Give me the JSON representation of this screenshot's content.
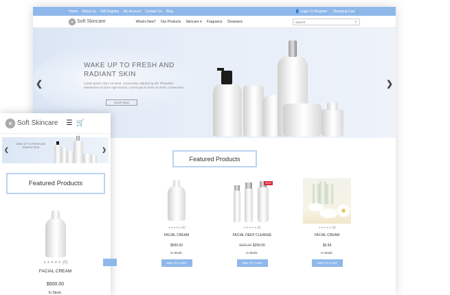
{
  "topbar": {
    "links": [
      "Home",
      "About Us",
      "Gift Registry",
      "My Account",
      "Contact Us",
      "Blog"
    ],
    "login": "Login Or Register",
    "cart": "Shopping Cart"
  },
  "brand": "Soft Skincare",
  "nav": {
    "items": [
      "What's New?",
      "Our Products",
      "Skincare",
      "Fragrance",
      "Cleansers"
    ],
    "search_placeholder": "Search"
  },
  "hero": {
    "title": "WAKE UP TO FRESH AND RADIANT SKIN",
    "body": "Lorem ipsum dolor sit amet, consectetur adipiscing elit. Phasellus elementum et tortor eget lacinia. Lorem ipsum dolor sit amet, consectetur.",
    "button": "SHOP NOW"
  },
  "featured_title": "Featured Products",
  "products": [
    {
      "name": "FACIAL CREAM",
      "rating_count": "(0)",
      "price": "$500.00",
      "old_price": "",
      "stock": "In Stock.",
      "button": "ADD TO CART",
      "sale": ""
    },
    {
      "name": "FACIAL DEEP CLEANSE",
      "rating_count": "(0)",
      "price": "$299.00",
      "old_price": "$500.00",
      "stock": "In Stock.",
      "button": "ADD TO CART",
      "sale": "SALE"
    },
    {
      "name": "FACIAL CREAM",
      "rating_count": "(0)",
      "price": "$3.99",
      "old_price": "",
      "stock": "In Stock.",
      "button": "ADD TO CART",
      "sale": ""
    }
  ],
  "mobile": {
    "hero_title": "WAKE UP TO FRESH AND RADIANT SKIN",
    "product": {
      "name": "FACIAL CREAM",
      "rating_count": "(0)",
      "price": "$500.00",
      "stock": "In Stock."
    }
  },
  "icons": {
    "login": "user-icon",
    "cart": "cart-icon",
    "search": "search-icon",
    "menu": "hamburger-icon",
    "prev": "chevron-left-icon",
    "next": "chevron-right-icon",
    "dropdown": "caret-down-icon",
    "stars": "star-rating-icon"
  },
  "colors": {
    "accent": "#8fb8ea",
    "featured_border": "#b8d4f2",
    "sale": "#d9263b"
  }
}
